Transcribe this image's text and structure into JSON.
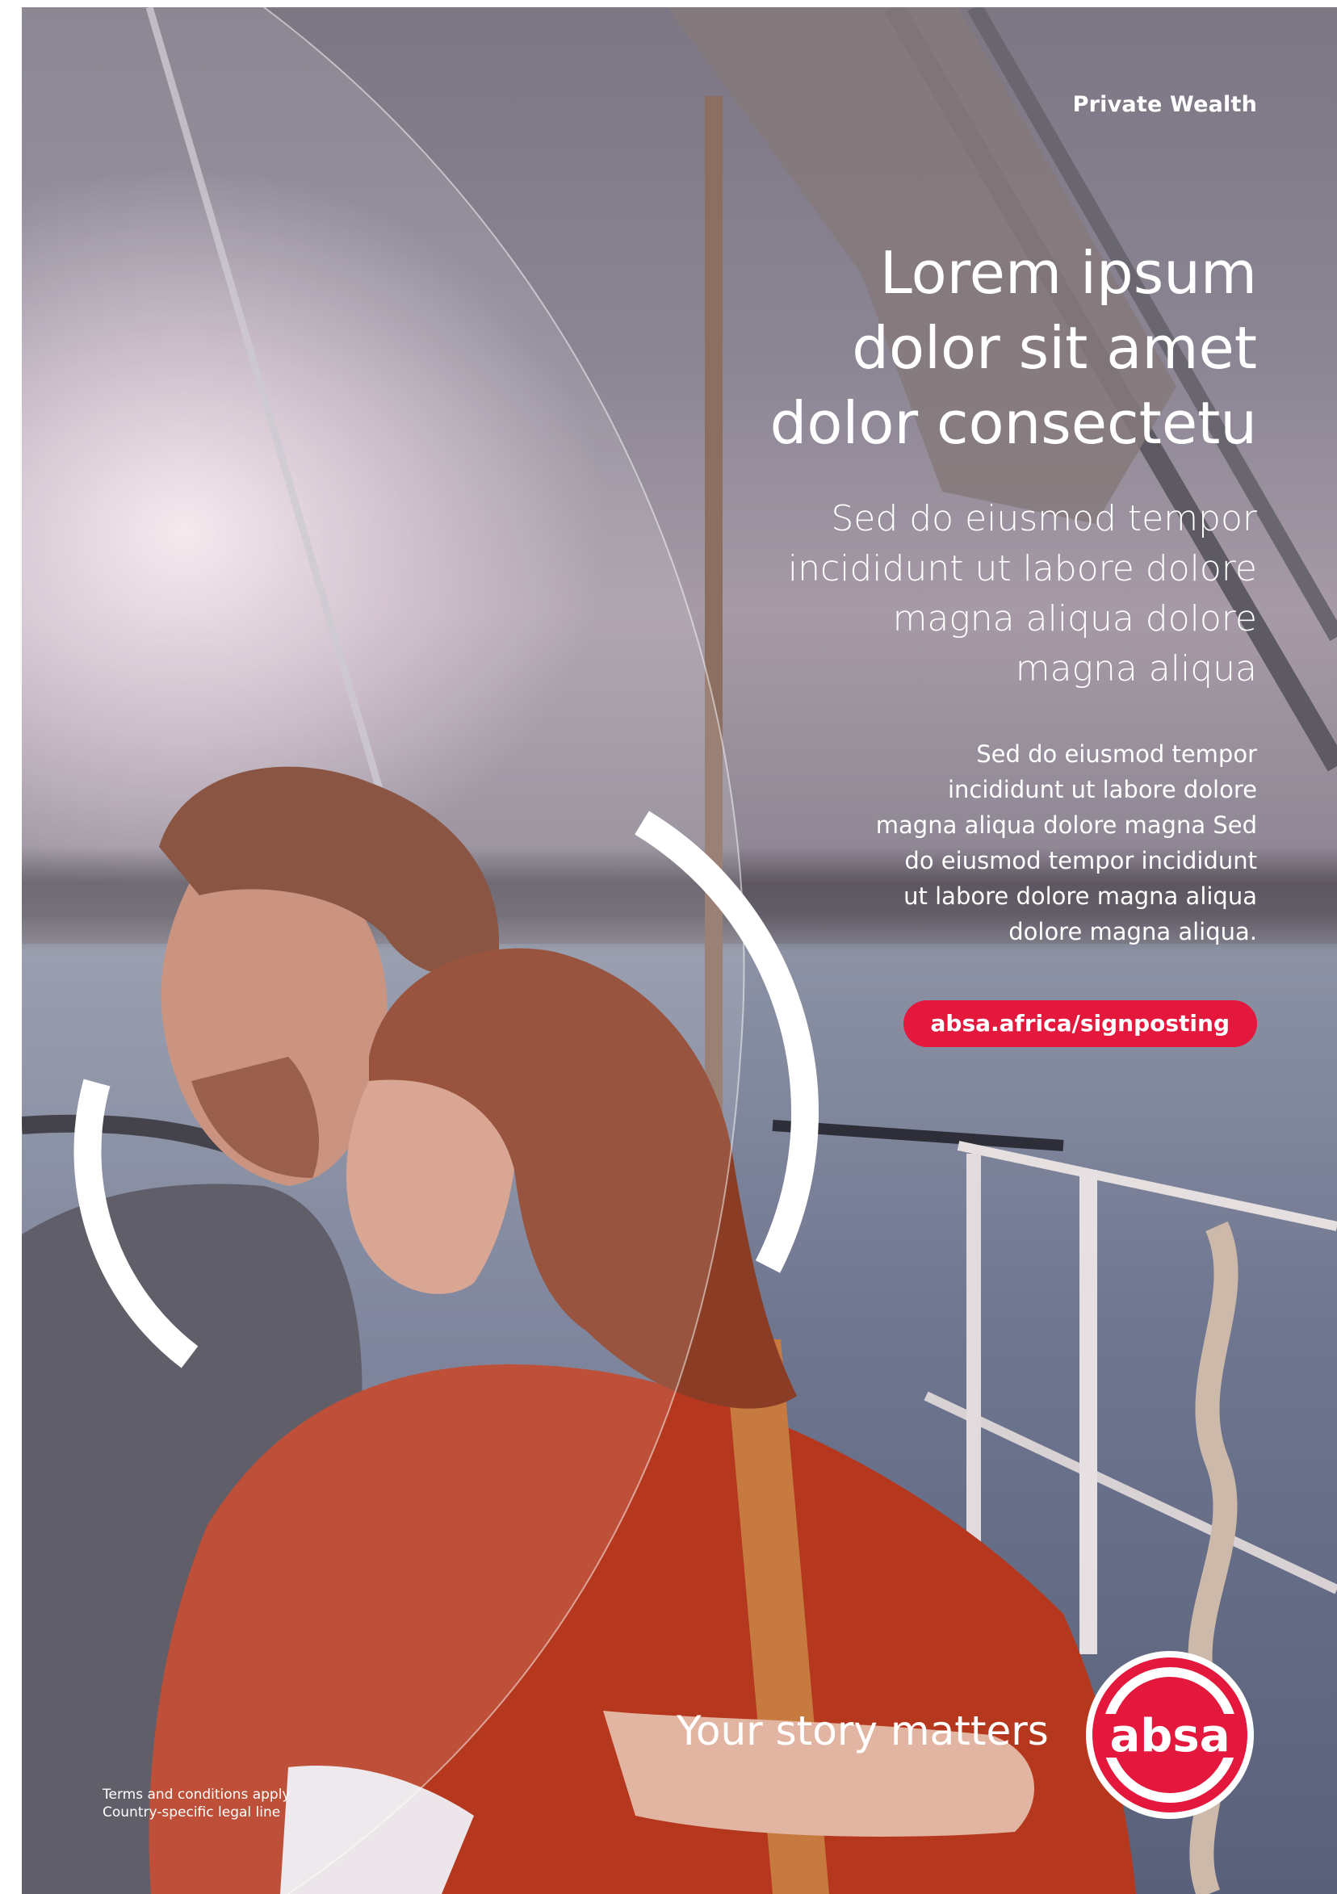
{
  "brand": {
    "division": "Private Wealth",
    "logo_text": "absa",
    "tagline": "Your story matters",
    "colors": {
      "red": "#e4183c",
      "white": "#ffffff"
    }
  },
  "headline": [
    "Lorem ipsum",
    "dolor sit amet",
    "dolor consectetu"
  ],
  "subhead": [
    "Sed do eiusmod tempor",
    "incididunt ut labore dolore",
    "magna aliqua dolore",
    "magna aliqua"
  ],
  "body": [
    "Sed do eiusmod tempor",
    "incididunt ut labore dolore",
    "magna aliqua dolore magna Sed",
    "do eiusmod tempor incididunt",
    "ut labore dolore magna aliqua",
    "dolore magna aliqua."
  ],
  "cta": {
    "label": "absa.africa/signposting"
  },
  "legal": [
    "Terms and conditions apply",
    "Country-specific legal line"
  ],
  "image": {
    "description_icon": "couple-on-sailboat-photo"
  }
}
